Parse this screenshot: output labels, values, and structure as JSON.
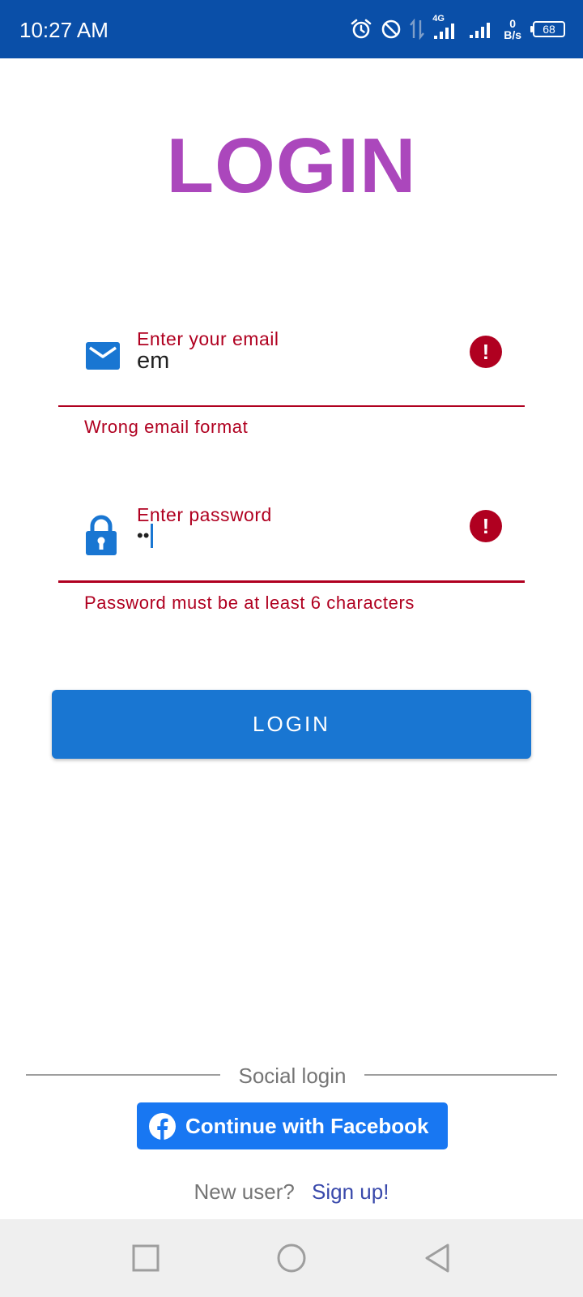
{
  "status_bar": {
    "time": "10:27 AM",
    "network": "4G",
    "speed_value": "0",
    "speed_unit": "B/s",
    "battery": "68"
  },
  "title": "LOGIN",
  "email_field": {
    "label": "Enter your email",
    "value": "em",
    "error": "Wrong email format"
  },
  "password_field": {
    "label": "Enter password",
    "masked_value": "••",
    "error": "Password must be at least 6 characters"
  },
  "login_button": "LOGIN",
  "social": {
    "divider_label": "Social login",
    "facebook_button": "Continue with Facebook"
  },
  "signup": {
    "prompt": "New user?",
    "link": "Sign up!"
  },
  "colors": {
    "status_bar": "#0a4fa8",
    "title": "#ab47bc",
    "primary": "#1976d2",
    "error": "#b00020",
    "facebook": "#1877f2",
    "link": "#3949ab"
  },
  "icons": [
    "alarm-icon",
    "do-not-disturb-icon",
    "data-arrows-icon",
    "signal-icon",
    "battery-icon",
    "email-icon",
    "lock-icon",
    "error-icon",
    "facebook-icon",
    "recents-icon",
    "home-icon",
    "back-icon"
  ]
}
